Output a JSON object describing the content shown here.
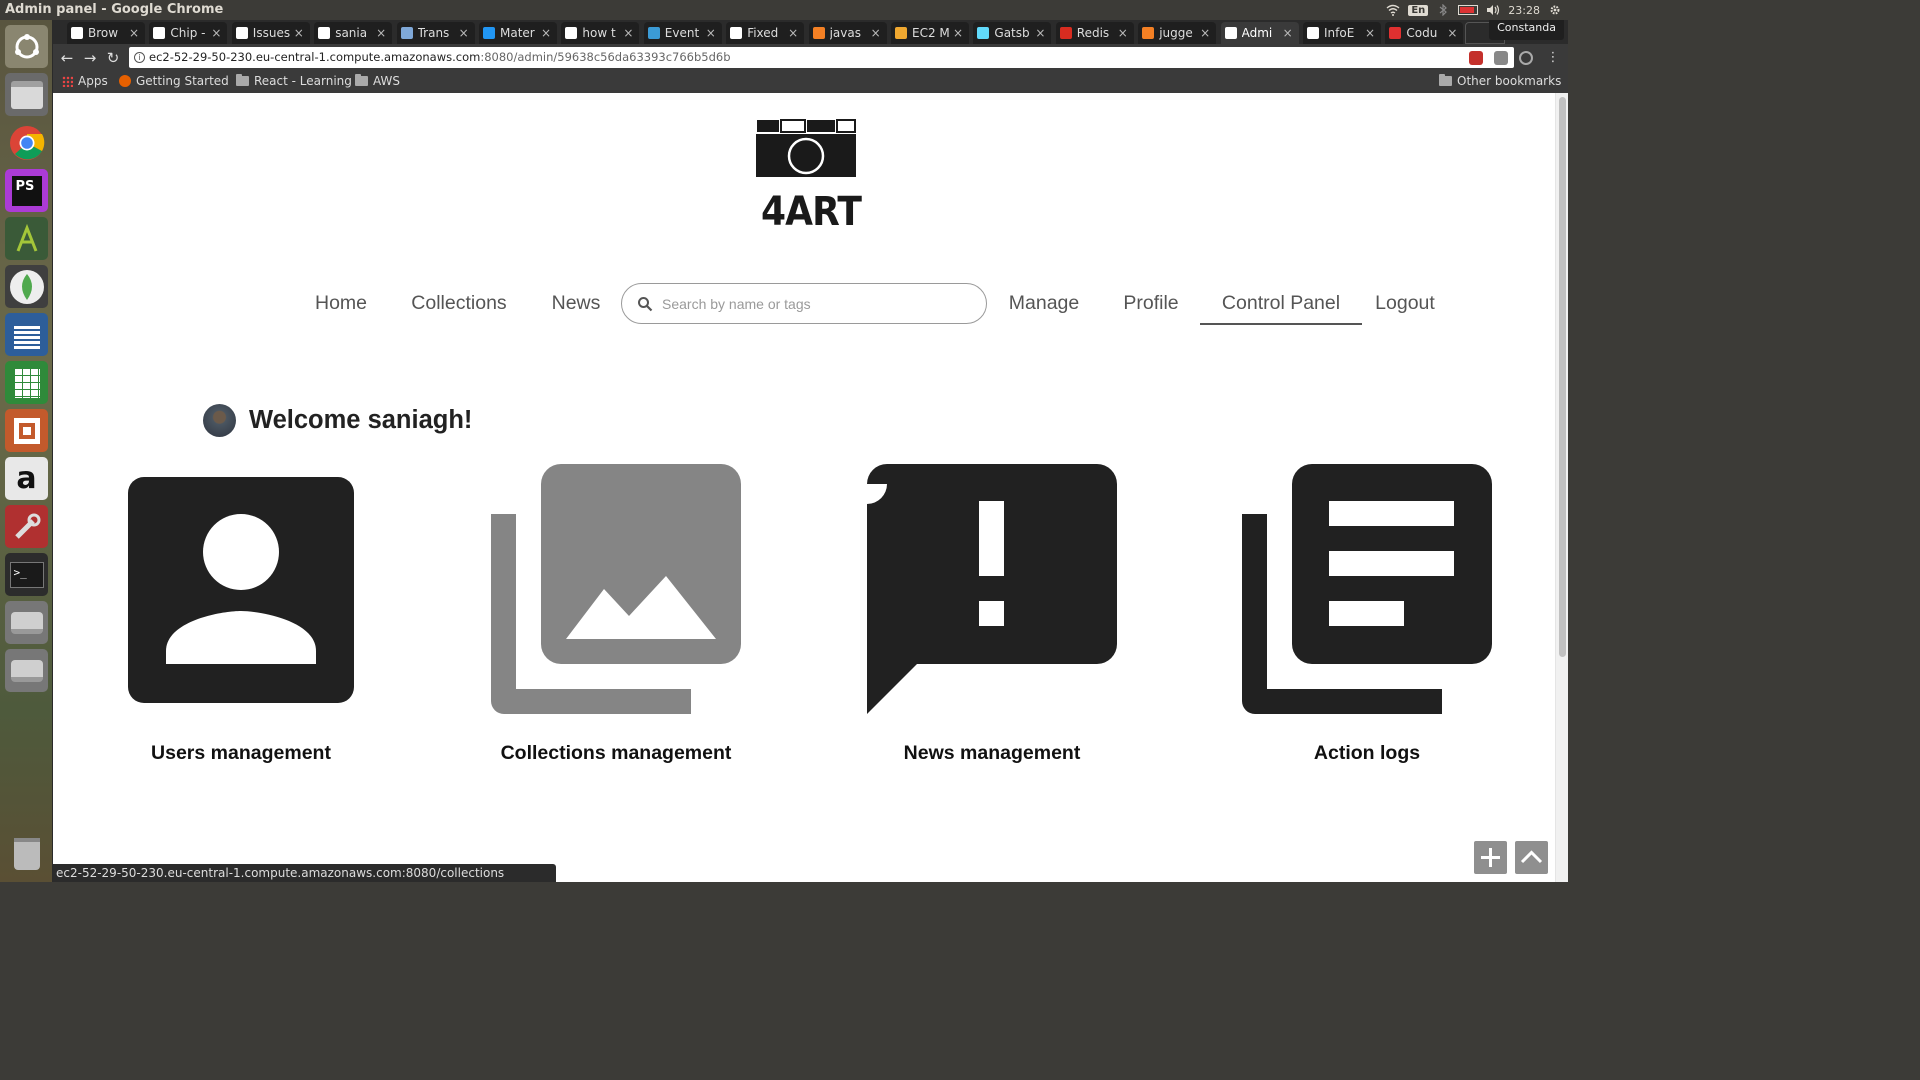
{
  "os": {
    "window_title": "Admin panel - Google Chrome",
    "lang": "En",
    "clock": "23:28",
    "user": "Constanda"
  },
  "browser": {
    "tabs": [
      {
        "label": "Brow",
        "favicon_color": "#ffffff"
      },
      {
        "label": "Chip -",
        "favicon_color": "#ffffff"
      },
      {
        "label": "Issues",
        "favicon_color": "#ffffff"
      },
      {
        "label": "sania",
        "favicon_color": "#ffffff"
      },
      {
        "label": "Trans",
        "favicon_color": "#7fa8d8"
      },
      {
        "label": "Mater",
        "favicon_color": "#2196f3"
      },
      {
        "label": "how t",
        "favicon_color": "#ffffff"
      },
      {
        "label": "Event",
        "favicon_color": "#3b9bd6"
      },
      {
        "label": "Fixed",
        "favicon_color": "#ffffff"
      },
      {
        "label": "javas",
        "favicon_color": "#f48024"
      },
      {
        "label": "EC2 M",
        "favicon_color": "#f0a830"
      },
      {
        "label": "Gatsb",
        "favicon_color": "#61dafb"
      },
      {
        "label": "Redis",
        "favicon_color": "#d82c20"
      },
      {
        "label": "jugge",
        "favicon_color": "#f48024"
      },
      {
        "label": "Admi",
        "favicon_color": "#ffffff",
        "active": true
      },
      {
        "label": "InfoE",
        "favicon_color": "#ffffff"
      },
      {
        "label": "Codu",
        "favicon_color": "#e03030"
      }
    ],
    "url_host": "ec2-52-29-50-230.eu-central-1.compute.amazonaws.com",
    "url_path": ":8080/admin/59638c56da63393c766b5d6b",
    "bookmarks": {
      "apps": "Apps",
      "getting_started": "Getting Started",
      "react_learning": "React - Learning",
      "aws": "AWS",
      "other": "Other bookmarks"
    },
    "status_url": "ec2-52-29-50-230.eu-central-1.compute.amazonaws.com:8080/collections"
  },
  "page": {
    "logo_text": "4ART",
    "nav": {
      "home": "Home",
      "collections": "Collections",
      "news": "News",
      "manage": "Manage",
      "profile": "Profile",
      "control_panel": "Control Panel",
      "logout": "Logout"
    },
    "search": {
      "placeholder": "Search by name or tags"
    },
    "welcome": "Welcome saniagh!",
    "cards": {
      "users": "Users management",
      "collections": "Collections management",
      "news": "News management",
      "logs": "Action logs"
    },
    "colors": {
      "icon_dark": "#212121",
      "icon_grey": "#858585"
    }
  }
}
